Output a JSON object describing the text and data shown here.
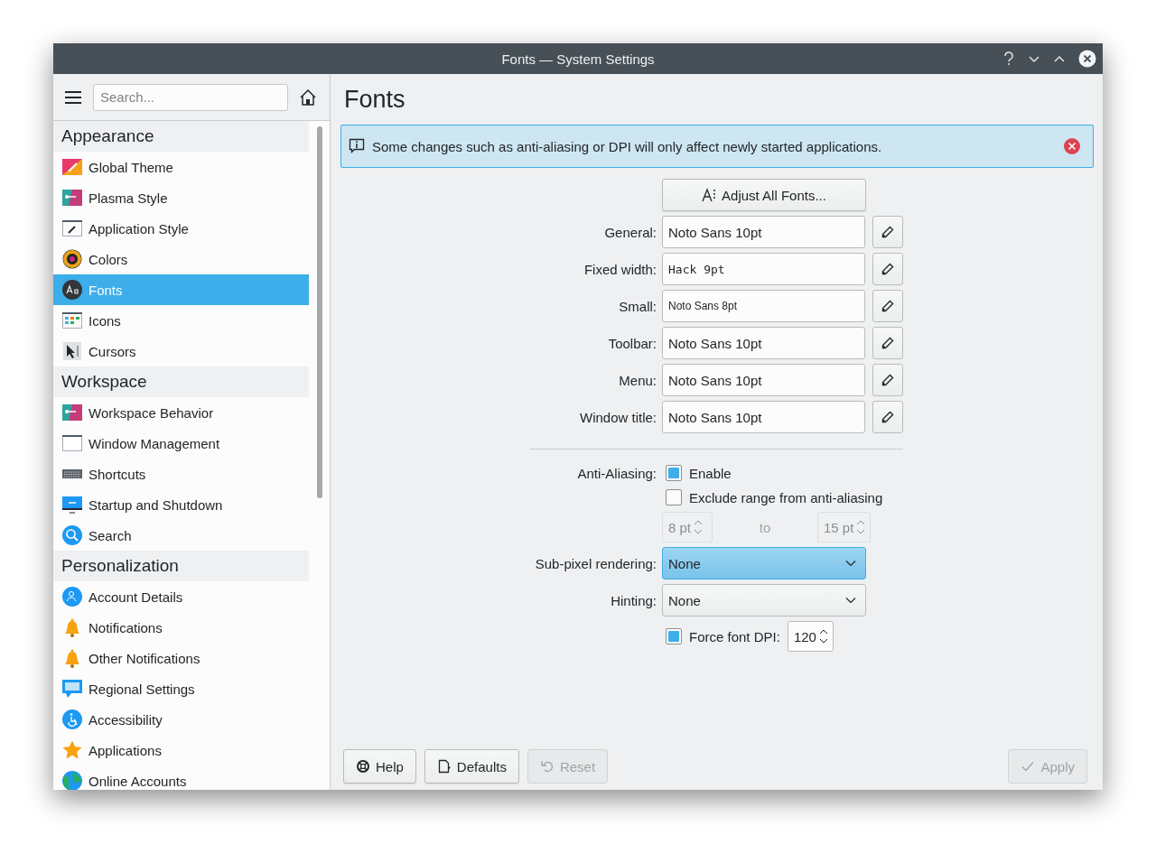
{
  "window": {
    "title": "Fonts — System Settings"
  },
  "sidebar": {
    "search": {
      "placeholder": "Search..."
    },
    "groups": [
      {
        "title": "Appearance",
        "items": [
          {
            "label": "Global Theme",
            "kind": "theme",
            "selected": false
          },
          {
            "label": "Plasma Style",
            "kind": "plasma",
            "selected": false
          },
          {
            "label": "Application Style",
            "kind": "brush",
            "selected": false
          },
          {
            "label": "Colors",
            "kind": "colors",
            "selected": false
          },
          {
            "label": "Fonts",
            "kind": "fonts",
            "selected": true
          },
          {
            "label": "Icons",
            "kind": "icons",
            "selected": false
          },
          {
            "label": "Cursors",
            "kind": "cursor",
            "selected": false
          }
        ]
      },
      {
        "title": "Workspace",
        "items": [
          {
            "label": "Workspace Behavior",
            "kind": "plasma",
            "selected": false
          },
          {
            "label": "Window Management",
            "kind": "window",
            "selected": false
          },
          {
            "label": "Shortcuts",
            "kind": "keyboard",
            "selected": false
          },
          {
            "label": "Startup and Shutdown",
            "kind": "monitor",
            "selected": false
          },
          {
            "label": "Search",
            "kind": "search",
            "selected": false
          }
        ]
      },
      {
        "title": "Personalization",
        "items": [
          {
            "label": "Account Details",
            "kind": "user",
            "selected": false
          },
          {
            "label": "Notifications",
            "kind": "bell",
            "selected": false
          },
          {
            "label": "Other Notifications",
            "kind": "bell",
            "selected": false
          },
          {
            "label": "Regional Settings",
            "kind": "speech",
            "selected": false
          },
          {
            "label": "Accessibility",
            "kind": "access",
            "selected": false
          },
          {
            "label": "Applications",
            "kind": "star",
            "selected": false
          },
          {
            "label": "Online Accounts",
            "kind": "globe",
            "selected": false
          }
        ]
      }
    ]
  },
  "page": {
    "title": "Fonts",
    "banner": "Some changes such as anti-aliasing or DPI will only affect newly started applications.",
    "adjust_button": "Adjust All Fonts...",
    "fonts": [
      {
        "label": "General:",
        "value": "Noto Sans 10pt",
        "kind": "normal"
      },
      {
        "label": "Fixed width:",
        "value": "Hack 9pt",
        "kind": "mono"
      },
      {
        "label": "Small:",
        "value": "Noto Sans 8pt",
        "kind": "small"
      },
      {
        "label": "Toolbar:",
        "value": "Noto Sans 10pt",
        "kind": "normal"
      },
      {
        "label": "Menu:",
        "value": "Noto Sans 10pt",
        "kind": "normal"
      },
      {
        "label": "Window title:",
        "value": "Noto Sans 10pt",
        "kind": "normal"
      }
    ],
    "anti_aliasing": {
      "label": "Anti-Aliasing:",
      "enable": {
        "label": "Enable",
        "checked": true
      },
      "exclude": {
        "label": "Exclude range from anti-aliasing",
        "checked": false
      },
      "range": {
        "from": "8 pt",
        "to_label": "to",
        "to": "15 pt",
        "disabled": true
      }
    },
    "subpixel": {
      "label": "Sub-pixel rendering:",
      "value": "None",
      "focused": true
    },
    "hinting": {
      "label": "Hinting:",
      "value": "None",
      "focused": false
    },
    "force_dpi": {
      "label": "Force font DPI:",
      "checked": true,
      "value": "120"
    }
  },
  "footer": {
    "buttons": [
      {
        "label": "Help",
        "kind": "help",
        "disabled": false
      },
      {
        "label": "Defaults",
        "kind": "defaults",
        "disabled": false
      },
      {
        "label": "Reset",
        "kind": "reset",
        "disabled": true
      },
      {
        "label": "Apply",
        "kind": "apply",
        "disabled": true
      }
    ]
  }
}
